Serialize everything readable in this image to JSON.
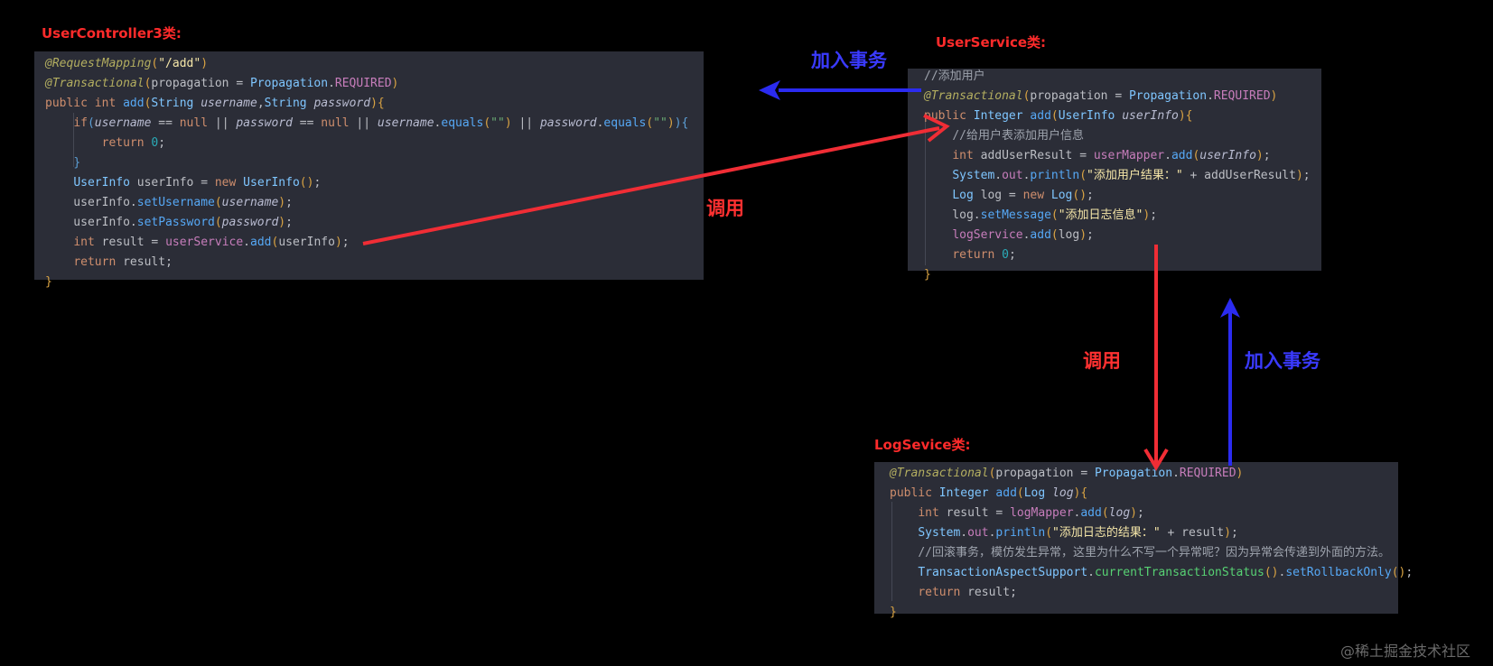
{
  "titles": {
    "controller": "UserController3类:",
    "service": "UserService类:",
    "log": "LogSevice类:"
  },
  "labels": {
    "join_tx_top": "加入事务",
    "call_mid": "调用",
    "call_right": "调用",
    "join_tx_right": "加入事务"
  },
  "colors": {
    "red_arrow": "#f02d35",
    "blue_arrow": "#2b2bf0",
    "title_red": "#ff2b2b",
    "panel_bg": "#2b2d37"
  },
  "code": {
    "controller": [
      [
        [
          "ann",
          "@RequestMapping"
        ],
        [
          "br1",
          "("
        ],
        [
          "str2",
          "\"/add\""
        ],
        [
          "br1",
          ")"
        ]
      ],
      [
        [
          "ann",
          "@Transactional"
        ],
        [
          "br1",
          "("
        ],
        [
          "",
          "propagation = "
        ],
        [
          "cls",
          "Propagation"
        ],
        [
          "",
          "."
        ],
        [
          "fld",
          "REQUIRED"
        ],
        [
          "br1",
          ")"
        ]
      ],
      [
        [
          "kw",
          "public int "
        ],
        [
          "mth",
          "add"
        ],
        [
          "br1",
          "("
        ],
        [
          "cls",
          "String "
        ],
        [
          "prm",
          "username"
        ],
        [
          "",
          ","
        ],
        [
          "cls",
          "String "
        ],
        [
          "prm",
          "password"
        ],
        [
          "br1",
          ")"
        ],
        [
          "br1",
          "{"
        ]
      ],
      [
        [
          "",
          "    "
        ],
        [
          "kw",
          "if"
        ],
        [
          "br2",
          "("
        ],
        [
          "prm",
          "username"
        ],
        [
          "",
          " == "
        ],
        [
          "kw",
          "null"
        ],
        [
          "",
          " || "
        ],
        [
          "prm",
          "password"
        ],
        [
          "",
          " == "
        ],
        [
          "kw",
          "null"
        ],
        [
          "",
          " || "
        ],
        [
          "prm",
          "username"
        ],
        [
          "",
          "."
        ],
        [
          "mth",
          "equals"
        ],
        [
          "br1",
          "("
        ],
        [
          "str",
          "\"\""
        ],
        [
          "br1",
          ")"
        ],
        [
          "",
          " || "
        ],
        [
          "prm",
          "password"
        ],
        [
          "",
          "."
        ],
        [
          "mth",
          "equals"
        ],
        [
          "br1",
          "("
        ],
        [
          "str",
          "\"\""
        ],
        [
          "br1",
          ")"
        ],
        [
          "br2",
          ")"
        ],
        [
          "br2",
          "{"
        ]
      ],
      [
        [
          "",
          "        "
        ],
        [
          "kw",
          "return "
        ],
        [
          "num",
          "0"
        ],
        [
          "",
          ";"
        ]
      ],
      [
        [
          "",
          "    "
        ],
        [
          "br2",
          "}"
        ]
      ],
      [
        [
          "",
          "    "
        ],
        [
          "cls",
          "UserInfo "
        ],
        [
          "",
          "userInfo = "
        ],
        [
          "kw",
          "new "
        ],
        [
          "cls",
          "UserInfo"
        ],
        [
          "br1",
          "()"
        ],
        [
          "",
          ";"
        ]
      ],
      [
        [
          "",
          "    userInfo."
        ],
        [
          "mth",
          "setUsername"
        ],
        [
          "br1",
          "("
        ],
        [
          "prm",
          "username"
        ],
        [
          "br1",
          ")"
        ],
        [
          "",
          ";"
        ]
      ],
      [
        [
          "",
          "    userInfo."
        ],
        [
          "mth",
          "setPassword"
        ],
        [
          "br1",
          "("
        ],
        [
          "prm",
          "password"
        ],
        [
          "br1",
          ")"
        ],
        [
          "",
          ";"
        ]
      ],
      [
        [
          "",
          "    "
        ],
        [
          "kw",
          "int "
        ],
        [
          "",
          "result = "
        ],
        [
          "fld",
          "userService"
        ],
        [
          "",
          "."
        ],
        [
          "mth",
          "add"
        ],
        [
          "br1",
          "("
        ],
        [
          "",
          "userInfo"
        ],
        [
          "br1",
          ")"
        ],
        [
          "",
          ";"
        ]
      ],
      [
        [
          "",
          "    "
        ],
        [
          "kw",
          "return "
        ],
        [
          "",
          "result;"
        ]
      ],
      [
        [
          "br1",
          "}"
        ]
      ]
    ],
    "service": [
      [
        [
          "cmt",
          "//添加用户"
        ]
      ],
      [
        [
          "ann",
          "@Transactional"
        ],
        [
          "br1",
          "("
        ],
        [
          "",
          "propagation = "
        ],
        [
          "cls",
          "Propagation"
        ],
        [
          "",
          "."
        ],
        [
          "fld",
          "REQUIRED"
        ],
        [
          "br1",
          ")"
        ]
      ],
      [
        [
          "kw",
          "public "
        ],
        [
          "cls",
          "Integer "
        ],
        [
          "mth",
          "add"
        ],
        [
          "br1",
          "("
        ],
        [
          "cls",
          "UserInfo "
        ],
        [
          "prm",
          "userInfo"
        ],
        [
          "br1",
          ")"
        ],
        [
          "br1",
          "{"
        ]
      ],
      [
        [
          "",
          "    "
        ],
        [
          "cmt",
          "//给用户表添加用户信息"
        ]
      ],
      [
        [
          "",
          "    "
        ],
        [
          "kw",
          "int "
        ],
        [
          "",
          "addUserResult = "
        ],
        [
          "fld",
          "userMapper"
        ],
        [
          "",
          "."
        ],
        [
          "mth",
          "add"
        ],
        [
          "br1",
          "("
        ],
        [
          "prm",
          "userInfo"
        ],
        [
          "br1",
          ")"
        ],
        [
          "",
          ";"
        ]
      ],
      [
        [
          "",
          "    "
        ],
        [
          "cls",
          "System"
        ],
        [
          "",
          "."
        ],
        [
          "fld",
          "out"
        ],
        [
          "",
          "."
        ],
        [
          "mth",
          "println"
        ],
        [
          "br1",
          "("
        ],
        [
          "str2",
          "\"添加用户结果：\""
        ],
        [
          "",
          " + addUserResult"
        ],
        [
          "br1",
          ")"
        ],
        [
          "",
          ";"
        ]
      ],
      [
        [
          "",
          "    "
        ],
        [
          "cls",
          "Log "
        ],
        [
          "",
          "log = "
        ],
        [
          "kw",
          "new "
        ],
        [
          "cls",
          "Log"
        ],
        [
          "br1",
          "()"
        ],
        [
          "",
          ";"
        ]
      ],
      [
        [
          "",
          "    log."
        ],
        [
          "mth",
          "setMessage"
        ],
        [
          "br1",
          "("
        ],
        [
          "str2",
          "\"添加日志信息\""
        ],
        [
          "br1",
          ")"
        ],
        [
          "",
          ";"
        ]
      ],
      [
        [
          "",
          "    "
        ],
        [
          "fld",
          "logService"
        ],
        [
          "",
          "."
        ],
        [
          "mth",
          "add"
        ],
        [
          "br1",
          "("
        ],
        [
          "",
          "log"
        ],
        [
          "br1",
          ")"
        ],
        [
          "",
          ";"
        ]
      ],
      [
        [
          "",
          "    "
        ],
        [
          "kw",
          "return "
        ],
        [
          "num",
          "0"
        ],
        [
          "",
          ";"
        ]
      ],
      [
        [
          "br1",
          "}"
        ]
      ]
    ],
    "log": [
      [
        [
          "ann",
          "@Transactional"
        ],
        [
          "br1",
          "("
        ],
        [
          "",
          "propagation = "
        ],
        [
          "cls",
          "Propagation"
        ],
        [
          "",
          "."
        ],
        [
          "fld",
          "REQUIRED"
        ],
        [
          "br1",
          ")"
        ]
      ],
      [
        [
          "kw",
          "public "
        ],
        [
          "cls",
          "Integer "
        ],
        [
          "mth",
          "add"
        ],
        [
          "br1",
          "("
        ],
        [
          "cls",
          "Log "
        ],
        [
          "prm",
          "log"
        ],
        [
          "br1",
          ")"
        ],
        [
          "br1",
          "{"
        ]
      ],
      [
        [
          "",
          "    "
        ],
        [
          "kw",
          "int "
        ],
        [
          "",
          "result = "
        ],
        [
          "fld",
          "logMapper"
        ],
        [
          "",
          "."
        ],
        [
          "mth",
          "add"
        ],
        [
          "br1",
          "("
        ],
        [
          "prm",
          "log"
        ],
        [
          "br1",
          ")"
        ],
        [
          "",
          ";"
        ]
      ],
      [
        [
          "",
          "    "
        ],
        [
          "cls",
          "System"
        ],
        [
          "",
          "."
        ],
        [
          "fld",
          "out"
        ],
        [
          "",
          "."
        ],
        [
          "mth",
          "println"
        ],
        [
          "br1",
          "("
        ],
        [
          "str2",
          "\"添加日志的结果：\""
        ],
        [
          "",
          " + result"
        ],
        [
          "br1",
          ")"
        ],
        [
          "",
          ";"
        ]
      ],
      [
        [
          "",
          "    "
        ],
        [
          "cmt",
          "//回滚事务，模仿发生异常，这里为什么不写一个异常呢？因为异常会传递到外面的方法。"
        ]
      ],
      [
        [
          "",
          "    "
        ],
        [
          "cls",
          "TransactionAspectSupport"
        ],
        [
          "",
          "."
        ],
        [
          "fn2",
          "currentTransactionStatus"
        ],
        [
          "br1",
          "()"
        ],
        [
          "",
          "."
        ],
        [
          "mth",
          "setRollbackOnly"
        ],
        [
          "br1",
          "()"
        ],
        [
          "",
          ";"
        ]
      ],
      [
        [
          "",
          "    "
        ],
        [
          "kw",
          "return "
        ],
        [
          "",
          "result;"
        ]
      ],
      [
        [
          "br1",
          "}"
        ]
      ]
    ]
  },
  "watermark": "@稀土掘金技术社区"
}
